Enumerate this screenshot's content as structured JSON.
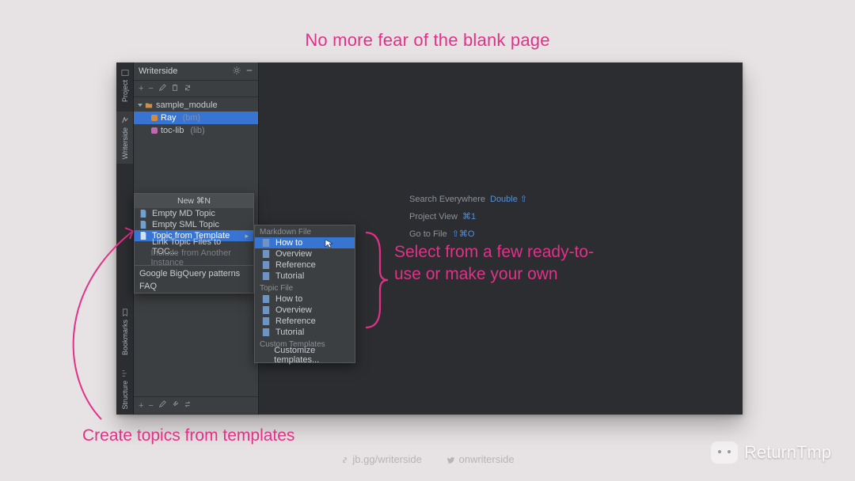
{
  "headline": "No more fear of the blank page",
  "captions": {
    "select": "Select from a few ready-to-use or make your own",
    "templates": "Create topics from templates"
  },
  "footer": {
    "link": "jb.gg/writerside",
    "handle": "onwriterside"
  },
  "watermark": "ReturnTmp",
  "strip": {
    "items": [
      {
        "name": "project",
        "label": "Project",
        "active": false
      },
      {
        "name": "writerside",
        "label": "Writerside",
        "active": true
      },
      {
        "name": "structure",
        "label": "Structure",
        "active": false
      },
      {
        "name": "bookmarks",
        "label": "Bookmarks",
        "active": false
      }
    ]
  },
  "sidebar": {
    "title": "Writerside",
    "toolbar_top": [
      "+",
      "−",
      "pen",
      "clip",
      "sync"
    ],
    "tree": [
      {
        "label": "sample_module",
        "level": 1,
        "open": true,
        "kind": "folder"
      },
      {
        "label": "Ray",
        "suffix": "(bm)",
        "level": 2,
        "selected": true,
        "color": "orange"
      },
      {
        "label": "toc-lib",
        "suffix": "(lib)",
        "level": 2,
        "selected": false,
        "color": "pink"
      }
    ],
    "toolbar_mid": [
      "+",
      "−",
      "pen",
      "wrench",
      "swap"
    ]
  },
  "new_menu": {
    "header": "New ⌘N",
    "items": [
      {
        "label": "Empty MD Topic",
        "icon": "doc"
      },
      {
        "label": "Empty SML Topic",
        "icon": "doc"
      },
      {
        "label": "Topic from Template",
        "icon": "doc",
        "selected": true,
        "submenu": true
      },
      {
        "label": "Link Topic Files to TOC...",
        "icon": "none"
      },
      {
        "label": "Include from Another Instance",
        "icon": "none",
        "disabled": true
      }
    ],
    "footer": [
      {
        "label": "Google BigQuery patterns"
      },
      {
        "label": "FAQ"
      }
    ]
  },
  "submenu": {
    "groups": [
      {
        "title": "Markdown File",
        "items": [
          "How to",
          "Overview",
          "Reference",
          "Tutorial"
        ],
        "selected": 0
      },
      {
        "title": "Topic File",
        "items": [
          "How to",
          "Overview",
          "Reference",
          "Tutorial"
        ]
      },
      {
        "title": "Custom Templates",
        "items": [
          "Customize templates..."
        ]
      }
    ]
  },
  "editor_placeholder": [
    {
      "label": "Search Everywhere",
      "shortcut": "Double ⇧"
    },
    {
      "label": "Project View",
      "shortcut": "⌘1"
    },
    {
      "label": "Go to File",
      "shortcut": "⇧⌘O"
    }
  ],
  "colors": {
    "accent": "#e23188",
    "select": "#3874d1"
  }
}
